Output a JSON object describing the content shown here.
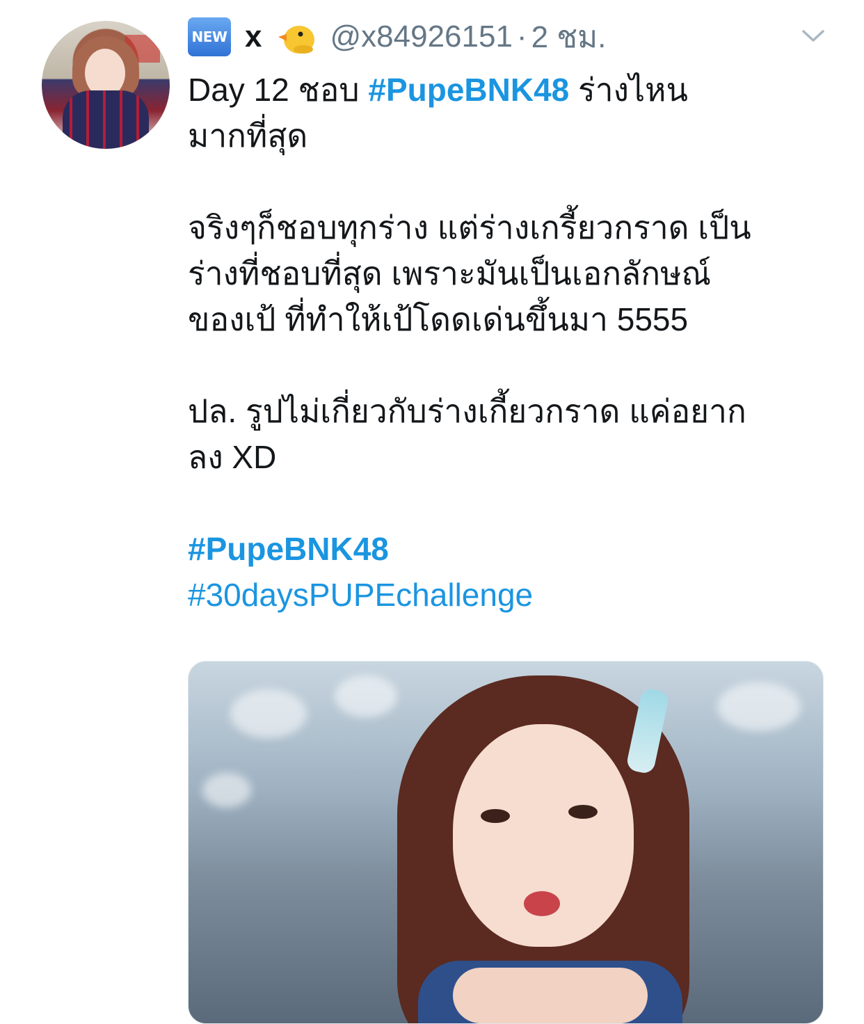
{
  "author": {
    "badge_label": "NEW",
    "display_name": "x",
    "emoji_icon": "baby-chick-icon",
    "handle": "@x84926151",
    "separator": "·",
    "timestamp": "2 ชม.",
    "menu_icon": "chevron-down-icon"
  },
  "tweet": {
    "line1_prefix": "Day 12 ชอบ ",
    "line1_hashtag": "#PupeBNK48",
    "line1_suffix": " ร่างไหน",
    "line2": "มากที่สุด",
    "para2_line1": "จริงๆก็ชอบทุกร่าง แต่ร่างเกรี้ยวกราด เป็น",
    "para2_line2": "ร่างที่ชอบที่สุด เพราะมันเป็นเอกลักษณ์",
    "para2_line3": "ของเป้ ที่ทำให้เป้โดดเด่นขึ้นมา 5555",
    "para3_line1": "ปล. รูปไม่เกี่ยวกับร่างเกี้ยวกราด แค่อยาก",
    "para3_line2": "ลง XD",
    "hashtag1": "#PupeBNK48",
    "hashtag2": "#30daysPUPEchallenge"
  },
  "colors": {
    "link": "#1b95e0",
    "secondary_text": "#657786",
    "primary_text": "#14171a"
  }
}
